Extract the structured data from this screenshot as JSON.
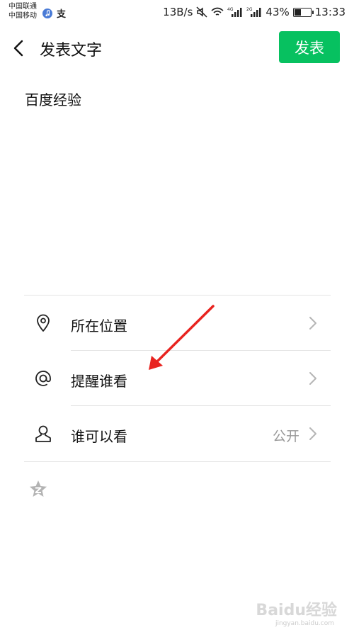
{
  "status_bar": {
    "carrier_1": "中国联通",
    "carrier_2": "中国移动",
    "alipay_glyph": "支",
    "net_speed": "13B/s",
    "network_4g": "4G",
    "network_2g": "2G",
    "battery_text": "43%",
    "battery_level": 0.43,
    "time": "13:33"
  },
  "header": {
    "title": "发表文字",
    "publish_label": "发表"
  },
  "post": {
    "text": "百度经验"
  },
  "options": [
    {
      "label": "所在位置",
      "value": "",
      "icon": "location-pin-icon"
    },
    {
      "label": "提醒谁看",
      "value": "",
      "icon": "at-sign-icon"
    },
    {
      "label": "谁可以看",
      "value": "公开",
      "icon": "person-icon"
    }
  ],
  "watermark": {
    "brand": "Baidu经验",
    "url": "jingyan.baidu.com"
  },
  "colors": {
    "accent": "#07c160",
    "annotation": "#e8231f"
  }
}
